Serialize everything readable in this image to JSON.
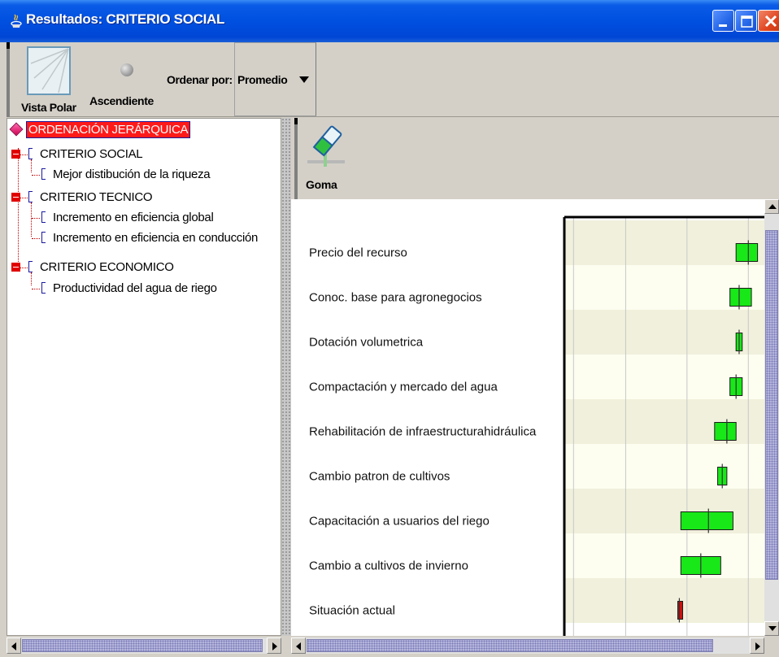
{
  "window": {
    "title": "Resultados: CRITERIO SOCIAL",
    "colors": {
      "titlebar": "#0050e0",
      "close": "#e0451f"
    }
  },
  "toolbar": {
    "polar_view_label": "Vista Polar",
    "ascending_label": "Ascendiente",
    "sort_by_label": "Ordenar por:",
    "sort_value": "Promedio"
  },
  "tree": {
    "root": "ORDENACIÓN JERÁRQUICA",
    "groups": [
      {
        "label": "CRITERIO SOCIAL",
        "children": [
          "Mejor distibución de la riqueza"
        ]
      },
      {
        "label": "CRITERIO TECNICO",
        "children": [
          "Incremento en eficiencia global",
          "Incremento en eficiencia en conducción"
        ]
      },
      {
        "label": "CRITERIO ECONOMICO",
        "children": [
          "Productividad del agua de riego"
        ]
      }
    ]
  },
  "eraser_label": "Goma",
  "chart_data": {
    "type": "box",
    "categories": [
      "Precio del recurso",
      "Conoc. base para agronegocios",
      "Dotación volumetrica",
      "Compactación y mercado del agua",
      "Rehabilitación de infraestructurahidráulica",
      "Cambio patron de cultivos",
      "Capacitación a usuarios del riego",
      "Cambio a cultivos de invierno",
      "Situación actual"
    ],
    "boxes": [
      {
        "low": 0.86,
        "mid": 0.9,
        "high": 0.93,
        "color": "#18e818"
      },
      {
        "low": 0.84,
        "mid": 0.87,
        "high": 0.91,
        "color": "#18e818"
      },
      {
        "low": 0.86,
        "mid": 0.87,
        "high": 0.88,
        "color": "#18e818"
      },
      {
        "low": 0.84,
        "mid": 0.86,
        "high": 0.88,
        "color": "#18e818"
      },
      {
        "low": 0.79,
        "mid": 0.83,
        "high": 0.86,
        "color": "#18e818"
      },
      {
        "low": 0.8,
        "mid": 0.815,
        "high": 0.83,
        "color": "#18e818"
      },
      {
        "low": 0.68,
        "mid": 0.77,
        "high": 0.85,
        "color": "#18e818"
      },
      {
        "low": 0.68,
        "mid": 0.745,
        "high": 0.81,
        "color": "#18e818"
      },
      {
        "low": 0.67,
        "mid": 0.675,
        "high": 0.685,
        "color": "#cc1111"
      }
    ],
    "xlim": [
      0.3,
      1.0
    ],
    "gridlines": [
      0.33,
      0.5,
      0.7,
      0.9
    ],
    "grid": true,
    "row_colors": [
      "#f0f0dc",
      "#fdfdf0"
    ]
  }
}
